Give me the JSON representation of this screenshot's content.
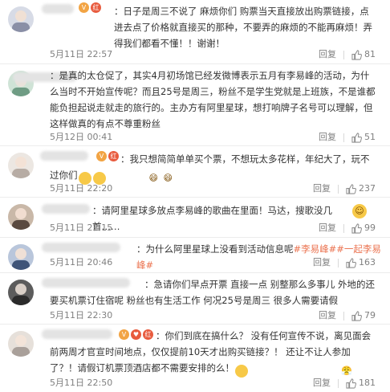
{
  "ui": {
    "reply_label": "回复",
    "colors": {
      "link": "#eb7350",
      "text": "#333333",
      "meta": "#808080"
    }
  },
  "comments": [
    {
      "text": "：日子是周三不说了 麻烦你们 购票当天直接放出购票链接，点进去点了价格就直接买的那种，不要弄的麻烦的不能再麻烦！弄得我们都看不懂！！谢谢！",
      "time": "5月11日 22:57",
      "likes": "81"
    },
    {
      "text": "：是真的太仓促了，其实4月初场馆已经发微博表示五月有李易峰的活动，为什么当时不开始宣传呢？而且25号是周三，粉丝不是学生党就是上班族，不是谁都能负担起说走就走的旅行的。主办方有阿里星球，想打响牌子名号可以理解，但这样做真的有点不尊重粉丝",
      "time": "5月12日 00:41",
      "likes": "51"
    },
    {
      "text": "：我只想简简单单买个票，不想玩太多花样，年纪大了，玩不过你们",
      "time": "5月11日 22:20",
      "likes": "237"
    },
    {
      "text": "：请阿里星球多放点李易峰的歌曲在里面！马达，搜歌没几首……",
      "time": "5月11日 22:15",
      "likes": "99"
    },
    {
      "text_pre": "：为什么阿里星球上没看到活动信息呢",
      "text_hl": "#李易峰##一起李易峰#",
      "time": "5月11日 20:46",
      "likes": "163"
    },
    {
      "text": "：急请你们早点开票 直接一点 别整那么多事儿 外地的还要买机票订住宿呢 粉丝也有生活工作 何况25号是周三 很多人需要请假",
      "time": "5月11日 22:30",
      "likes": "79"
    },
    {
      "text": "：你们到底在搞什么？ 没有任何宣传不说，离见面会前两周才官宣时间地点，仅仅提前10天才出购买链接？！ 还让不让人参加了？！请假订机票顶酒店都不需要安排的么！",
      "time": "5月11日 22:50",
      "likes": "181"
    }
  ]
}
